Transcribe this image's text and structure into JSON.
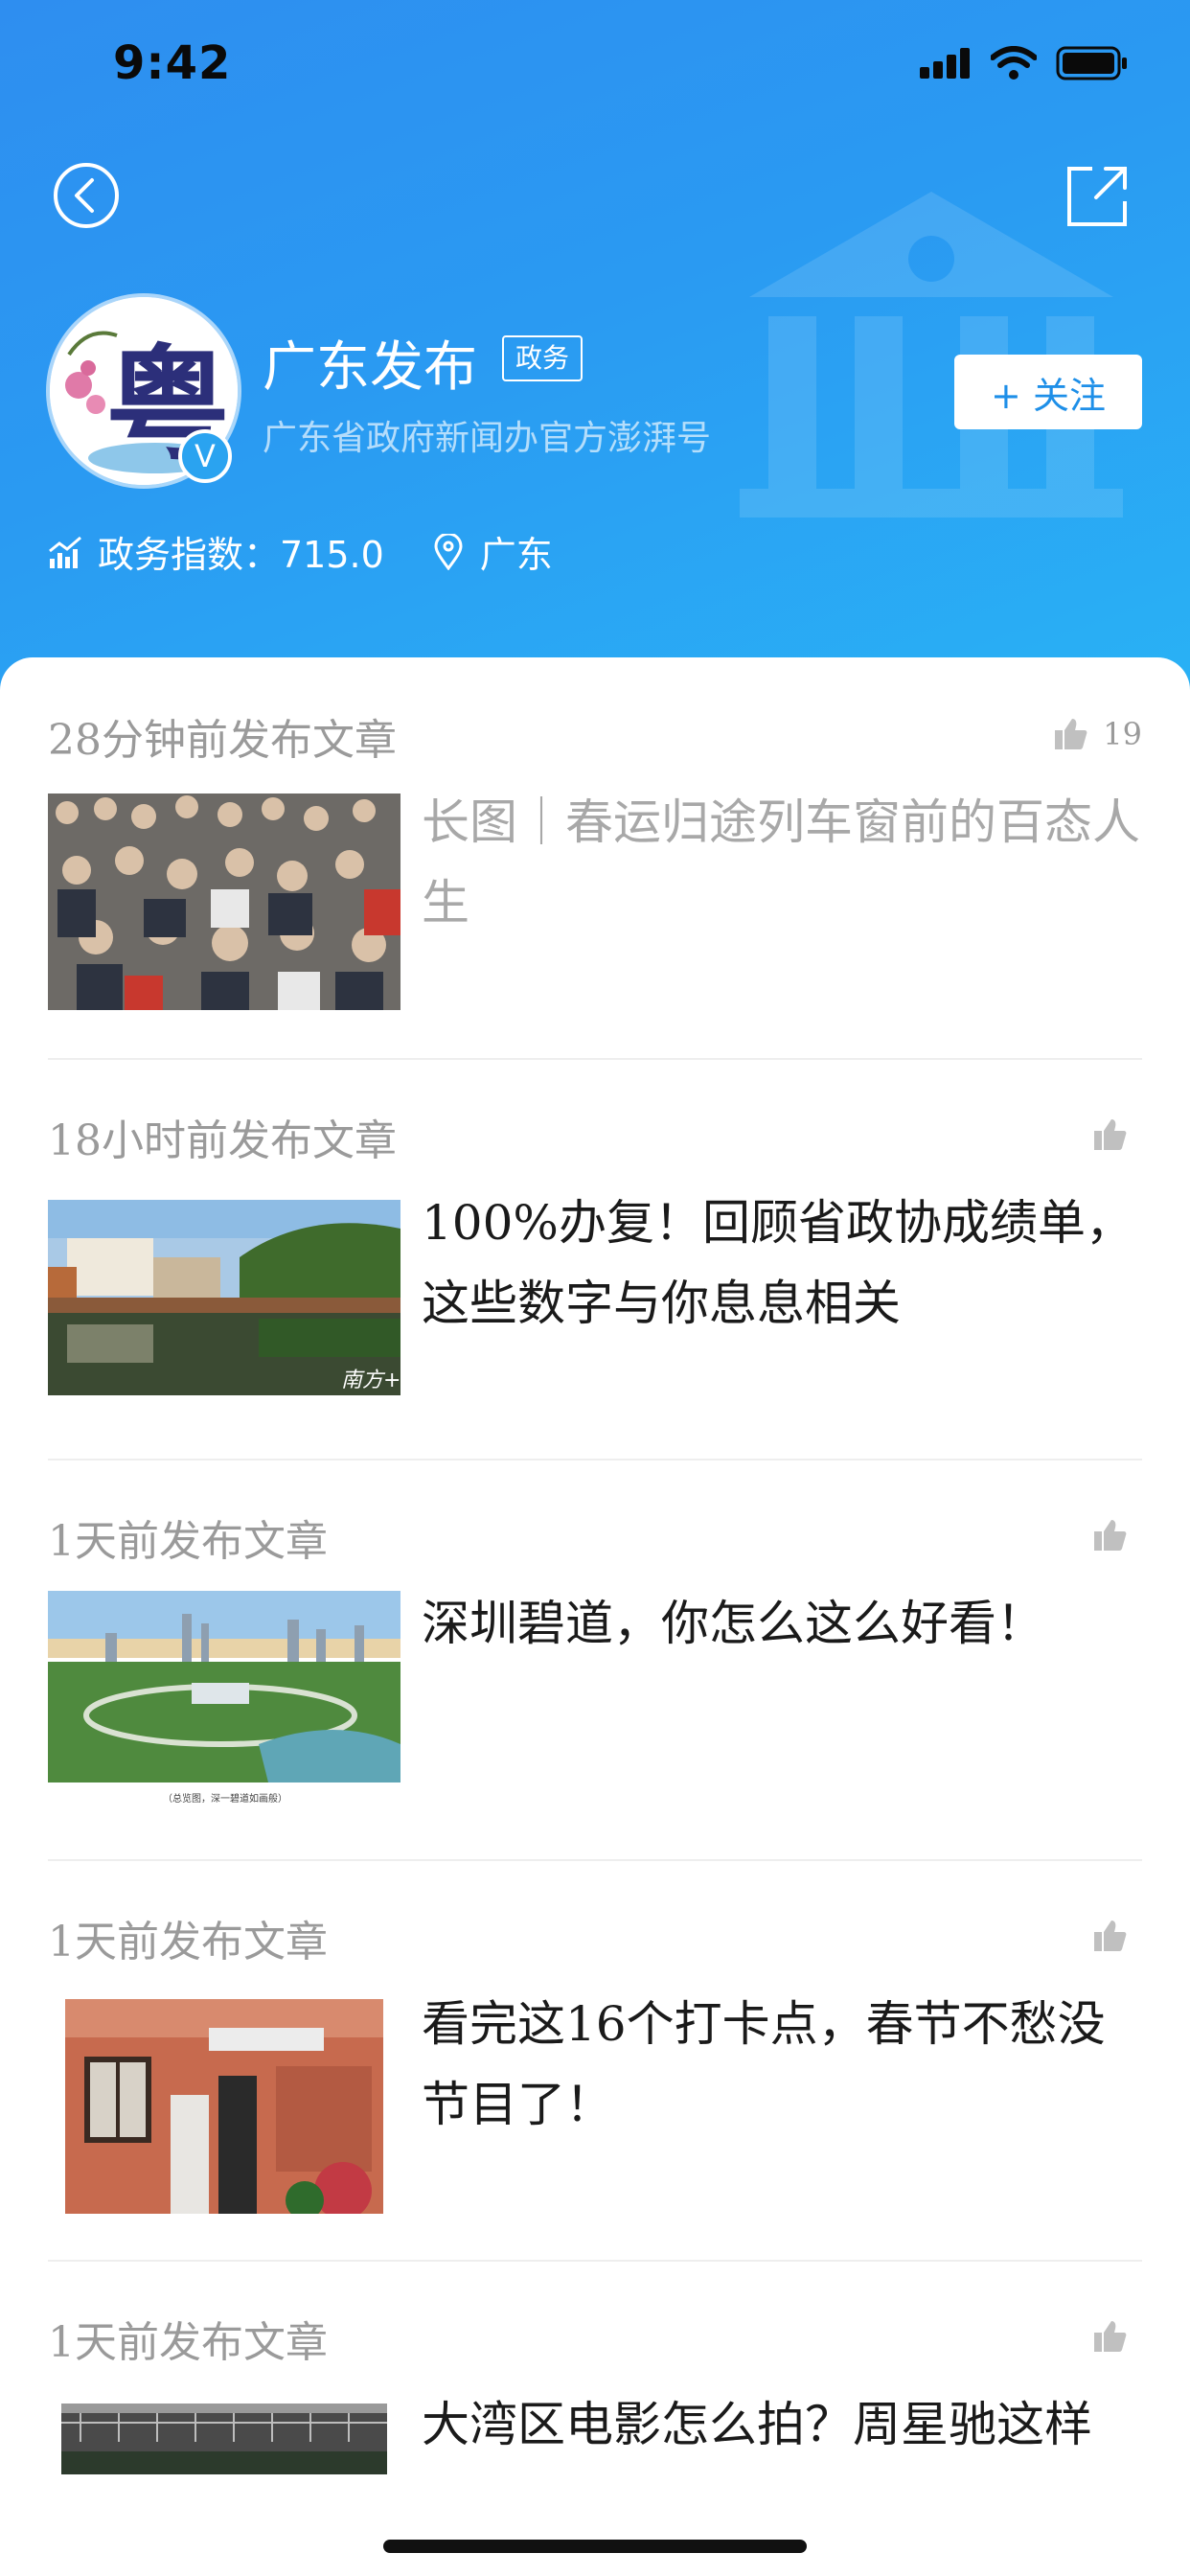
{
  "status_bar": {
    "time": "9:42"
  },
  "account": {
    "name": "广东发布",
    "tag": "政务",
    "description": "广东省政府新闻办官方澎湃号",
    "avatar_glyph": "粤",
    "verified_badge": "V",
    "follow_label": "+ 关注",
    "index_label": "政务指数：715.0",
    "location": "广东"
  },
  "articles": [
    {
      "time": "28分钟前发布文章",
      "likes": "19",
      "title": "长图｜春运归途列车窗前的百态人生",
      "read": true,
      "thumb": "crowd"
    },
    {
      "time": "18小时前发布文章",
      "likes": "",
      "title": "100%办复！回顾省政协成绩单，这些数字与你息息相关",
      "read": false,
      "thumb": "lake",
      "thumb_caption": "南方+"
    },
    {
      "time": "1天前发布文章",
      "likes": "",
      "title": "深圳碧道，你怎么这么好看！",
      "read": false,
      "thumb": "city",
      "thumb_caption": "（总览图，深一碧道如画般）"
    },
    {
      "time": "1天前发布文章",
      "likes": "",
      "title": "看完这16个打卡点，春节不愁没节目了！",
      "read": false,
      "thumb": "building"
    },
    {
      "time": "1天前发布文章",
      "likes": "",
      "title": "大湾区电影怎么拍？周星驰这样",
      "read": false,
      "thumb": "street"
    }
  ],
  "colors": {
    "header_blue": "#2e8ef0",
    "accent": "#1e8fe8",
    "muted": "#9a9a9a"
  }
}
